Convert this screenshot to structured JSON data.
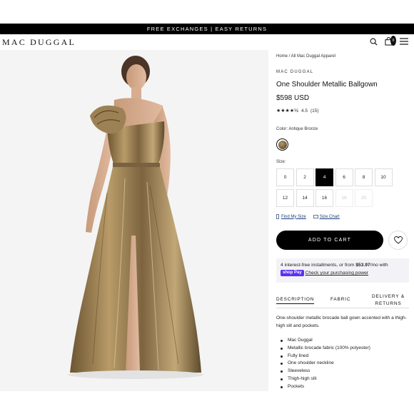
{
  "promo_bar": {
    "text": "FREE EXCHANGES | EASY RETURNS"
  },
  "header": {
    "logo": "MAC DUGGAL",
    "icons": [
      "search-icon",
      "bag-icon",
      "menu-icon"
    ],
    "cart_count": "0"
  },
  "product": {
    "breadcrumb": "Home / All Mac Duggal Apparel",
    "brand": "MAC DUGGAL",
    "title": "One Shoulder Metallic Ballgown",
    "price": "$598 USD",
    "rating_value": "4.5",
    "rating_count": "(15)",
    "color_label": "Color: Antique Bronze",
    "swatch_color": "#8a6f45",
    "size_label": "Size:",
    "sizes": [
      {
        "label": "0",
        "state": "available"
      },
      {
        "label": "2",
        "state": "available"
      },
      {
        "label": "4",
        "state": "selected"
      },
      {
        "label": "6",
        "state": "available"
      },
      {
        "label": "8",
        "state": "available"
      },
      {
        "label": "10",
        "state": "available"
      },
      {
        "label": "12",
        "state": "available"
      },
      {
        "label": "14",
        "state": "available"
      },
      {
        "label": "16",
        "state": "available"
      },
      {
        "label": "18",
        "state": "unavailable"
      },
      {
        "label": "20",
        "state": "unavailable"
      }
    ],
    "find_my_size": "Find My Size",
    "size_chart": "Size Chart",
    "add_to_cart": "ADD TO CART",
    "installments_prefix": "4 interest-free installments, or from",
    "installments_amount": "$53.97",
    "installments_suffix": "/mo with",
    "shop_pay": "shop Pay",
    "check_power": "Check your purchasing power",
    "tabs": [
      {
        "label": "DESCRIPTION",
        "active": true
      },
      {
        "label": "FABRIC",
        "active": false
      },
      {
        "label": "DELIVERY & RETURNS",
        "active": false
      }
    ],
    "description": "One-shoulder metallic brocade ball gown accented with a thigh-high slit and pockets.",
    "features": [
      "Mac Duggal",
      "Metallic brocade fabric (100% polyester)",
      "Fully lined",
      "One shoulder neckline",
      "Sleeveless",
      "Thigh-high slit",
      "Pockets"
    ]
  },
  "colors": {
    "primary": "#000000",
    "accent": "#5a31f4",
    "link": "#1a3d7c",
    "gown": "#a68b5b"
  }
}
